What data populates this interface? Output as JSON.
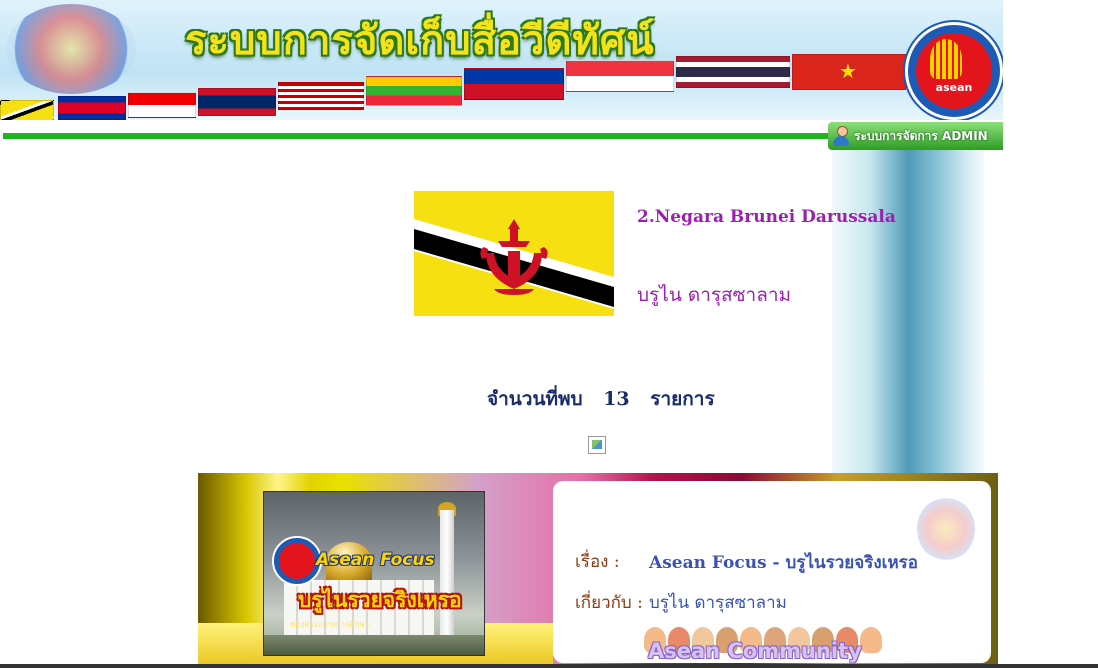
{
  "header": {
    "title": "ระบบการจัดเก็บสื่อวีดีทัศน์",
    "admin_link": "ระบบการจัดการ ADMIN",
    "seal_word": "asean"
  },
  "country": {
    "name_en": "2.Negara Brunei Darussala",
    "name_th": "บรูไน ดารุสซาลาม"
  },
  "results": {
    "label": "จำนวนที่พบ",
    "count": "13",
    "unit": "รายการ"
  },
  "video": {
    "thumb_series": "Asean Focus",
    "thumb_title": "บรูไนรวยจริงเหรอ",
    "thumb_subtitle": "ช่องสาระทางการศึกษา",
    "story_label": "เรื่อง :",
    "story_value": "Asean Focus - บรูไนรวยจริงเหรอ",
    "about_label": "เกี่ยวกับ :",
    "about_value": "บรูไน ดารุสซาลาม",
    "banner_word": "Asean Community"
  },
  "colors": {
    "accent_green": "#1fb51f",
    "country_text": "#9c1fb0",
    "count_text": "#1b2c6e",
    "info_value": "#3a52b5"
  }
}
